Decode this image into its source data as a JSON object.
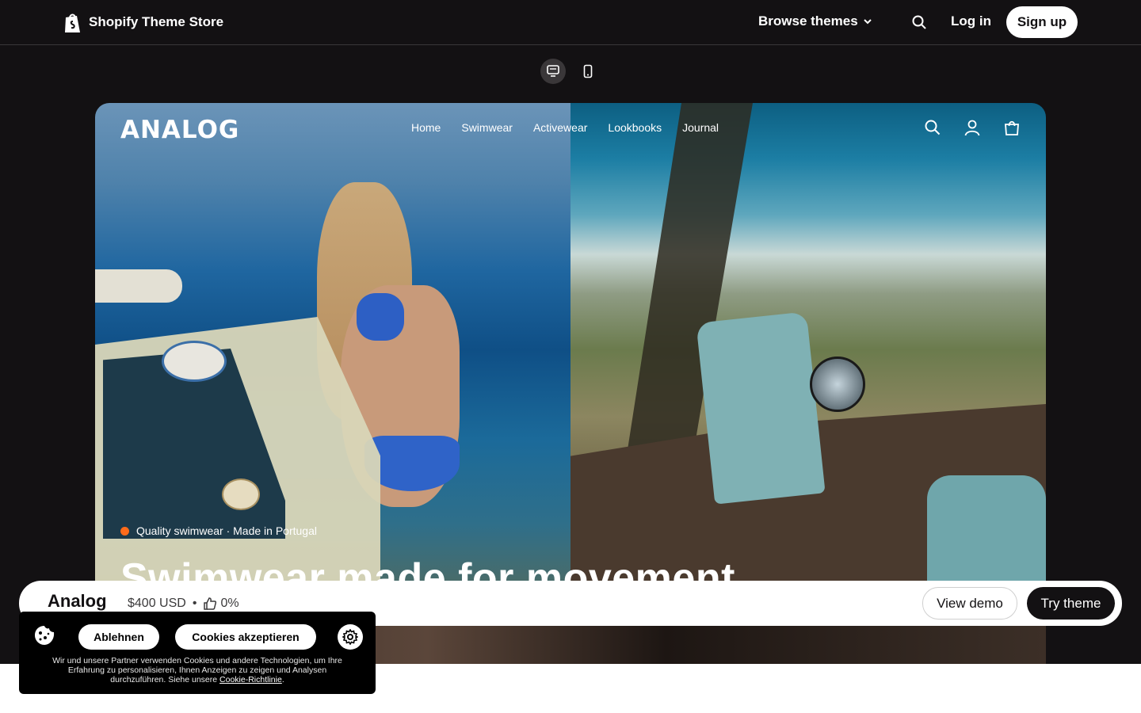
{
  "topnav": {
    "brand": "Shopify Theme Store",
    "browse_label": "Browse themes",
    "login_label": "Log in",
    "signup_label": "Sign up"
  },
  "preview": {
    "logo": "ANALOG",
    "nav": [
      "Home",
      "Swimwear",
      "Activewear",
      "Lookbooks",
      "Journal"
    ],
    "tagline": "Quality swimwear · Made in Portugal",
    "hero_title": "Swimwear made for movement"
  },
  "theme_bar": {
    "name": "Analog",
    "price": "$400 USD",
    "separator": "•",
    "rating": "0%",
    "view_demo": "View demo",
    "try_theme": "Try theme"
  },
  "cookie": {
    "decline": "Ablehnen",
    "accept": "Cookies akzeptieren",
    "text": "Wir und unsere Partner verwenden Cookies und andere Technologien, um Ihre Erfahrung zu personalisieren, Ihnen Anzeigen zu zeigen und Analysen durchzuführen. Siehe unsere ",
    "link": "Cookie-Richtlinie",
    "text_end": "."
  },
  "colors": {
    "page_bg": "#131113",
    "accent_dot": "#ff6b1a"
  }
}
